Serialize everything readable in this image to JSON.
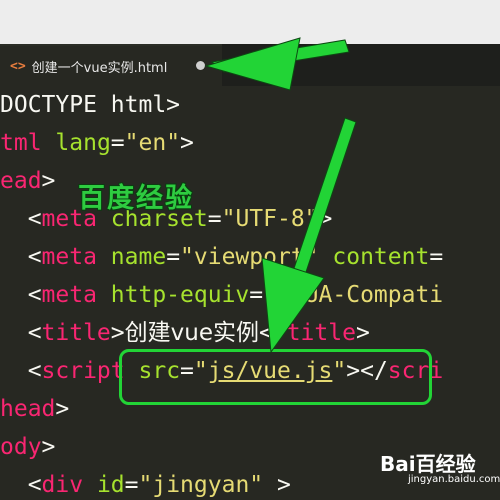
{
  "tab": {
    "icon": "code-file-icon",
    "icon_glyph": "<>",
    "filename": "创建一个vue实例.html",
    "unsaved_indicator": "modified-dot-icon"
  },
  "code_lines": [
    [
      {
        "c": "plain",
        "t": "DOCTYPE html>"
      }
    ],
    [
      {
        "c": "tag",
        "t": "tml"
      },
      {
        "c": "plain",
        "t": " "
      },
      {
        "c": "attr",
        "t": "lang"
      },
      {
        "c": "plain",
        "t": "="
      },
      {
        "c": "str",
        "t": "\"en\""
      },
      {
        "c": "plain",
        "t": ">"
      }
    ],
    [
      {
        "c": "tag",
        "t": "ead"
      },
      {
        "c": "plain",
        "t": ">"
      }
    ],
    [
      {
        "c": "plain",
        "t": "  <"
      },
      {
        "c": "tag",
        "t": "meta"
      },
      {
        "c": "plain",
        "t": " "
      },
      {
        "c": "attr",
        "t": "charset"
      },
      {
        "c": "plain",
        "t": "="
      },
      {
        "c": "str",
        "t": "\"UTF-8\""
      },
      {
        "c": "plain",
        "t": ">"
      }
    ],
    [
      {
        "c": "plain",
        "t": "  <"
      },
      {
        "c": "tag",
        "t": "meta"
      },
      {
        "c": "plain",
        "t": " "
      },
      {
        "c": "attr",
        "t": "name"
      },
      {
        "c": "plain",
        "t": "="
      },
      {
        "c": "str",
        "t": "\"viewport\""
      },
      {
        "c": "plain",
        "t": " "
      },
      {
        "c": "attr",
        "t": "content"
      },
      {
        "c": "plain",
        "t": "="
      }
    ],
    [
      {
        "c": "plain",
        "t": "  <"
      },
      {
        "c": "tag",
        "t": "meta"
      },
      {
        "c": "plain",
        "t": " "
      },
      {
        "c": "attr",
        "t": "http-equiv"
      },
      {
        "c": "plain",
        "t": "="
      },
      {
        "c": "str",
        "t": "\"X-UA-Compati"
      }
    ],
    [
      {
        "c": "plain",
        "t": "  <"
      },
      {
        "c": "tag",
        "t": "title"
      },
      {
        "c": "plain",
        "t": ">"
      },
      {
        "c": "plain cjk",
        "t": "创建vue实例"
      },
      {
        "c": "plain",
        "t": "</"
      },
      {
        "c": "tag",
        "t": "title"
      },
      {
        "c": "plain",
        "t": ">"
      }
    ],
    [
      {
        "c": "plain",
        "t": "  <"
      },
      {
        "c": "tag",
        "t": "script"
      },
      {
        "c": "plain",
        "t": " "
      },
      {
        "c": "attr",
        "t": "src"
      },
      {
        "c": "plain",
        "t": "="
      },
      {
        "c": "str",
        "t": "\""
      },
      {
        "c": "str link",
        "t": "js/vue.js"
      },
      {
        "c": "str",
        "t": "\""
      },
      {
        "c": "plain",
        "t": "></"
      },
      {
        "c": "tag",
        "t": "scri"
      }
    ],
    [
      {
        "c": "tag",
        "t": "head"
      },
      {
        "c": "plain",
        "t": ">"
      }
    ],
    [
      {
        "c": "tag",
        "t": "ody"
      },
      {
        "c": "plain",
        "t": ">"
      }
    ],
    [
      {
        "c": "plain",
        "t": "  <"
      },
      {
        "c": "tag",
        "t": "div"
      },
      {
        "c": "plain",
        "t": " "
      },
      {
        "c": "attr",
        "t": "id"
      },
      {
        "c": "plain",
        "t": "="
      },
      {
        "c": "str",
        "t": "\"jingyan\""
      },
      {
        "c": "plain",
        "t": " >"
      }
    ]
  ],
  "overlay_watermark": "百度经验",
  "baidu_logo": {
    "name": "Bai百经验",
    "sub": "jingyan.baidu.com"
  },
  "colors": {
    "tag": "#f92672",
    "attr": "#a6e22e",
    "string": "#e6db74",
    "annotation": "#22d436"
  }
}
